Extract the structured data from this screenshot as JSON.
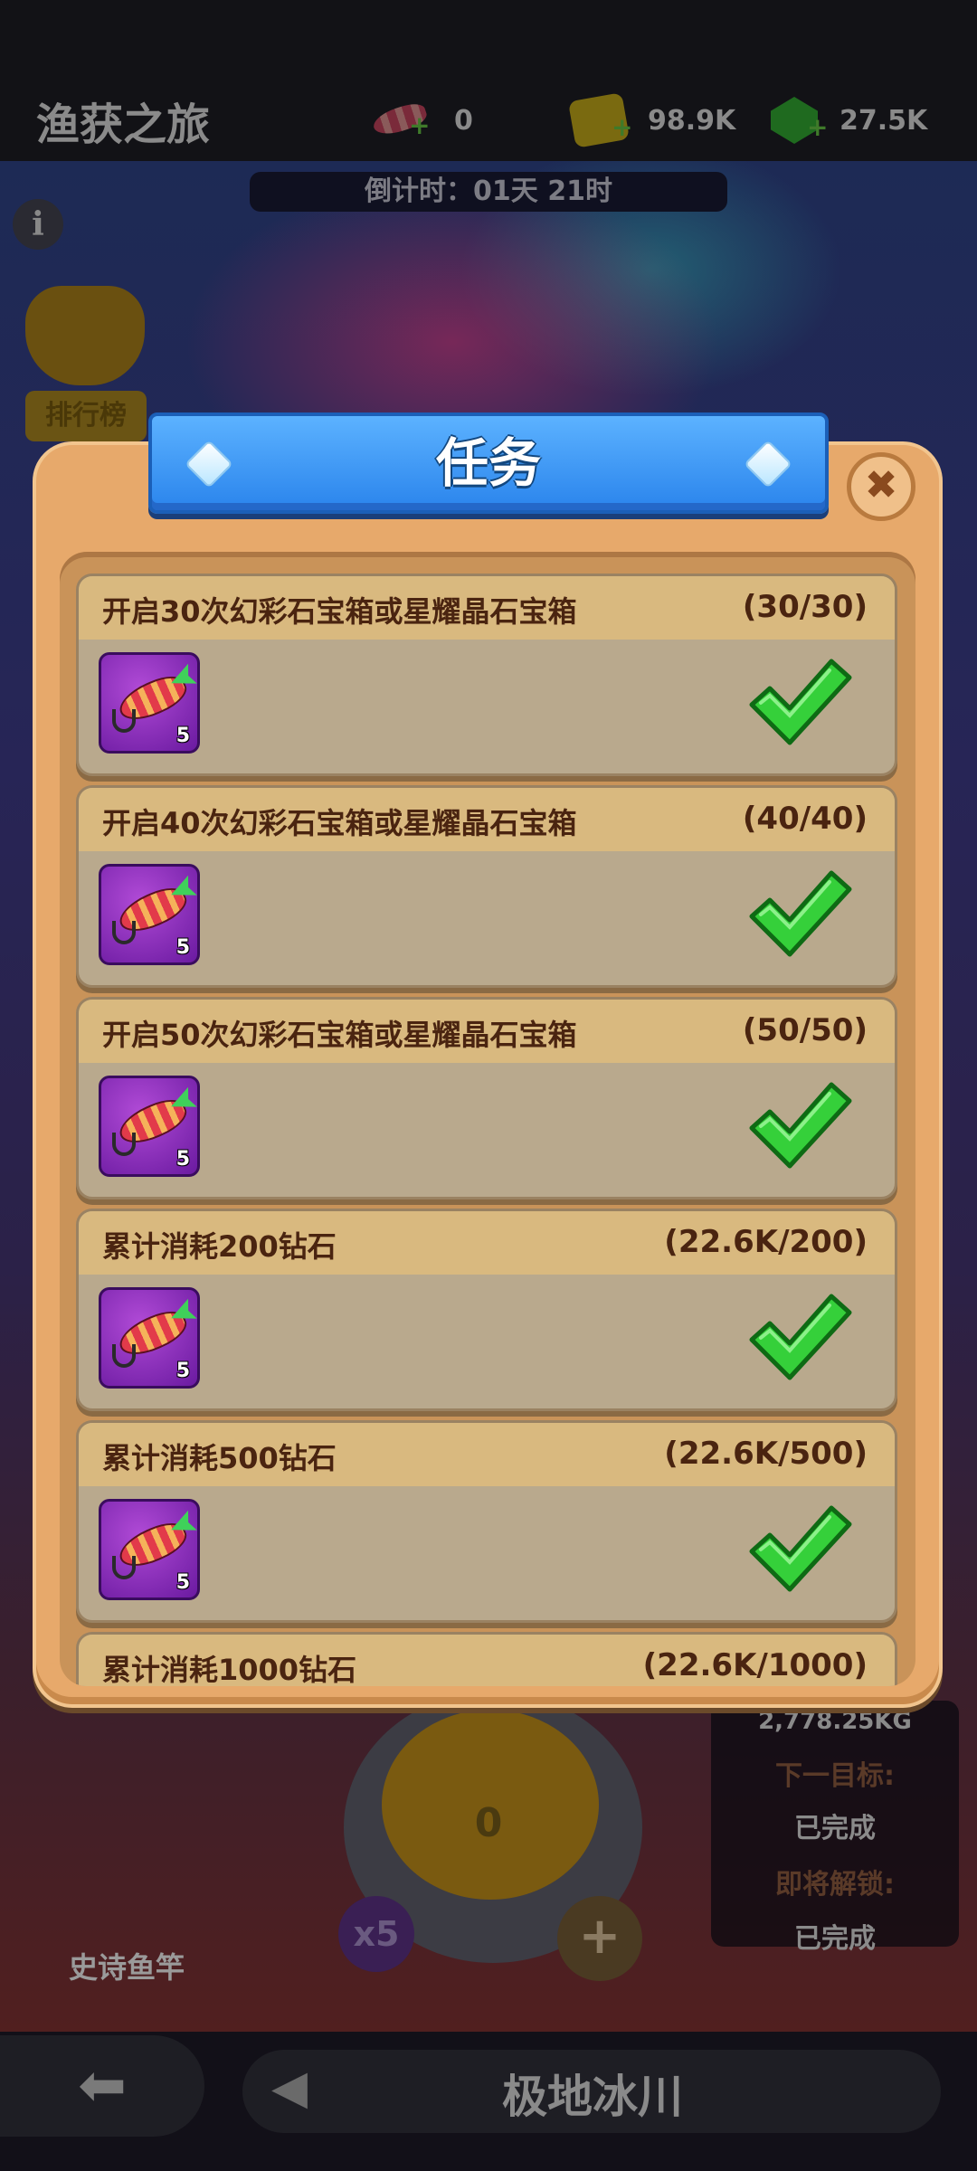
{
  "header": {
    "title": "渔获之旅",
    "lure_count": "0",
    "gold": "98.9K",
    "gems": "27.5K"
  },
  "countdown": "倒计时：01天 21时",
  "leaderboard_label": "排行榜",
  "modal": {
    "title": "任务",
    "close_icon": "close-icon",
    "tasks": [
      {
        "title": "开启30次幻彩石宝箱或星耀晶石宝箱",
        "progress": "(30/30)",
        "reward_qty": "5",
        "completed": true
      },
      {
        "title": "开启40次幻彩石宝箱或星耀晶石宝箱",
        "progress": "(40/40)",
        "reward_qty": "5",
        "completed": true
      },
      {
        "title": "开启50次幻彩石宝箱或星耀晶石宝箱",
        "progress": "(50/50)",
        "reward_qty": "5",
        "completed": true
      },
      {
        "title": "累计消耗200钻石",
        "progress": "(22.6K/200)",
        "reward_qty": "5",
        "completed": true
      },
      {
        "title": "累计消耗500钻石",
        "progress": "(22.6K/500)",
        "reward_qty": "5",
        "completed": true
      },
      {
        "title": "累计消耗1000钻石",
        "progress": "(22.6K/1000)"
      }
    ]
  },
  "reel": {
    "count": "0",
    "multiplier": "x5",
    "plus": "+"
  },
  "rod_label": "史诗鱼竿",
  "goal_panel": {
    "weight_partial": "2,778.25KG",
    "next_goal_label": "下一目标:",
    "next_goal_value": "已完成",
    "unlock_label": "即将解锁:",
    "unlock_value": "已完成"
  },
  "bottom_nav": {
    "zone_name": "极地冰川"
  },
  "colors": {
    "banner_blue": "#2a84ec",
    "check_green": "#35d03a",
    "modal_orange": "#e7a96b",
    "card_header": "#d9b97f",
    "reward_purple": "#8a2ac0"
  }
}
